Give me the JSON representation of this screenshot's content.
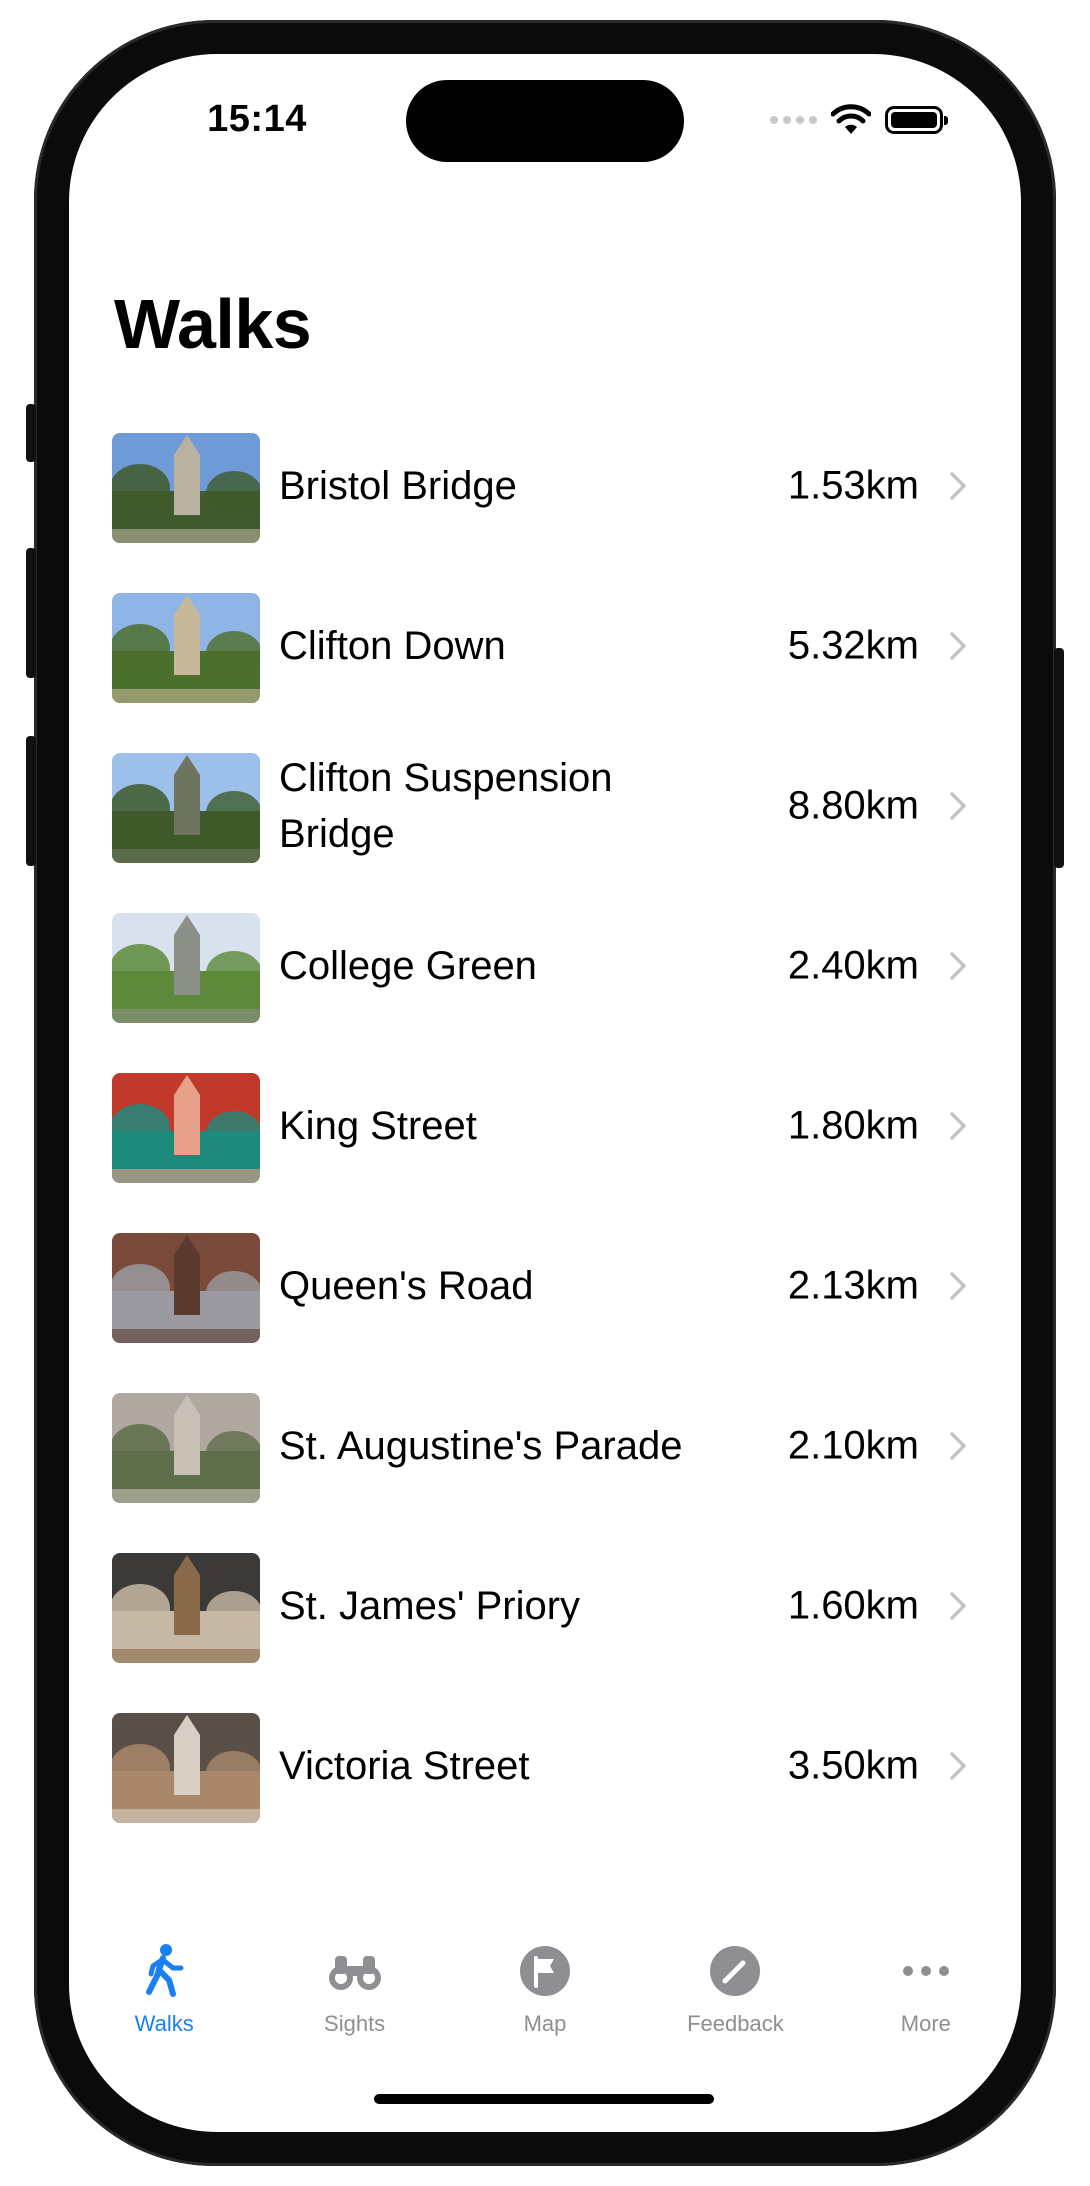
{
  "status_bar": {
    "time": "15:14"
  },
  "title": "Walks",
  "walks": [
    {
      "name": "Bristol Bridge",
      "distance": "1.53km",
      "thumb_colors": [
        "#6e9bd8",
        "#3f5a2c",
        "#b9b2a0"
      ]
    },
    {
      "name": "Clifton Down",
      "distance": "5.32km",
      "thumb_colors": [
        "#8fb4e6",
        "#4b6f2c",
        "#c7b899"
      ]
    },
    {
      "name": "Clifton Suspension Bridge",
      "distance": "8.80km",
      "thumb_colors": [
        "#9cc0ea",
        "#3e5a2a",
        "#6f7460"
      ]
    },
    {
      "name": "College Green",
      "distance": "2.40km",
      "thumb_colors": [
        "#d7e2ee",
        "#5d8a3a",
        "#8c8f88"
      ]
    },
    {
      "name": "King Street",
      "distance": "1.80km",
      "thumb_colors": [
        "#c0392b",
        "#1e8a7c",
        "#e7a08a"
      ]
    },
    {
      "name": "Queen's Road",
      "distance": "2.13km",
      "thumb_colors": [
        "#7a4a3a",
        "#9a9aa0",
        "#5b3a30"
      ]
    },
    {
      "name": "St. Augustine's Parade",
      "distance": "2.10km",
      "thumb_colors": [
        "#b0a8a0",
        "#5e6e4a",
        "#c9c0b5"
      ]
    },
    {
      "name": "St. James' Priory",
      "distance": "1.60km",
      "thumb_colors": [
        "#3c3a38",
        "#c5b8a4",
        "#8a6a4a"
      ]
    },
    {
      "name": "Victoria Street",
      "distance": "3.50km",
      "thumb_colors": [
        "#5a5048",
        "#a8876a",
        "#d8cfc4"
      ]
    }
  ],
  "tabs": [
    {
      "label": "Walks",
      "icon": "walking-figure-icon",
      "active": true
    },
    {
      "label": "Sights",
      "icon": "binoculars-icon",
      "active": false
    },
    {
      "label": "Map",
      "icon": "flag-circle-icon",
      "active": false
    },
    {
      "label": "Feedback",
      "icon": "pencil-circle-icon",
      "active": false
    },
    {
      "label": "More",
      "icon": "ellipsis-icon",
      "active": false
    }
  ],
  "colors": {
    "accent": "#1a80f2",
    "inactive_tab": "#8e8e93",
    "chevron": "#c4c4c7"
  }
}
